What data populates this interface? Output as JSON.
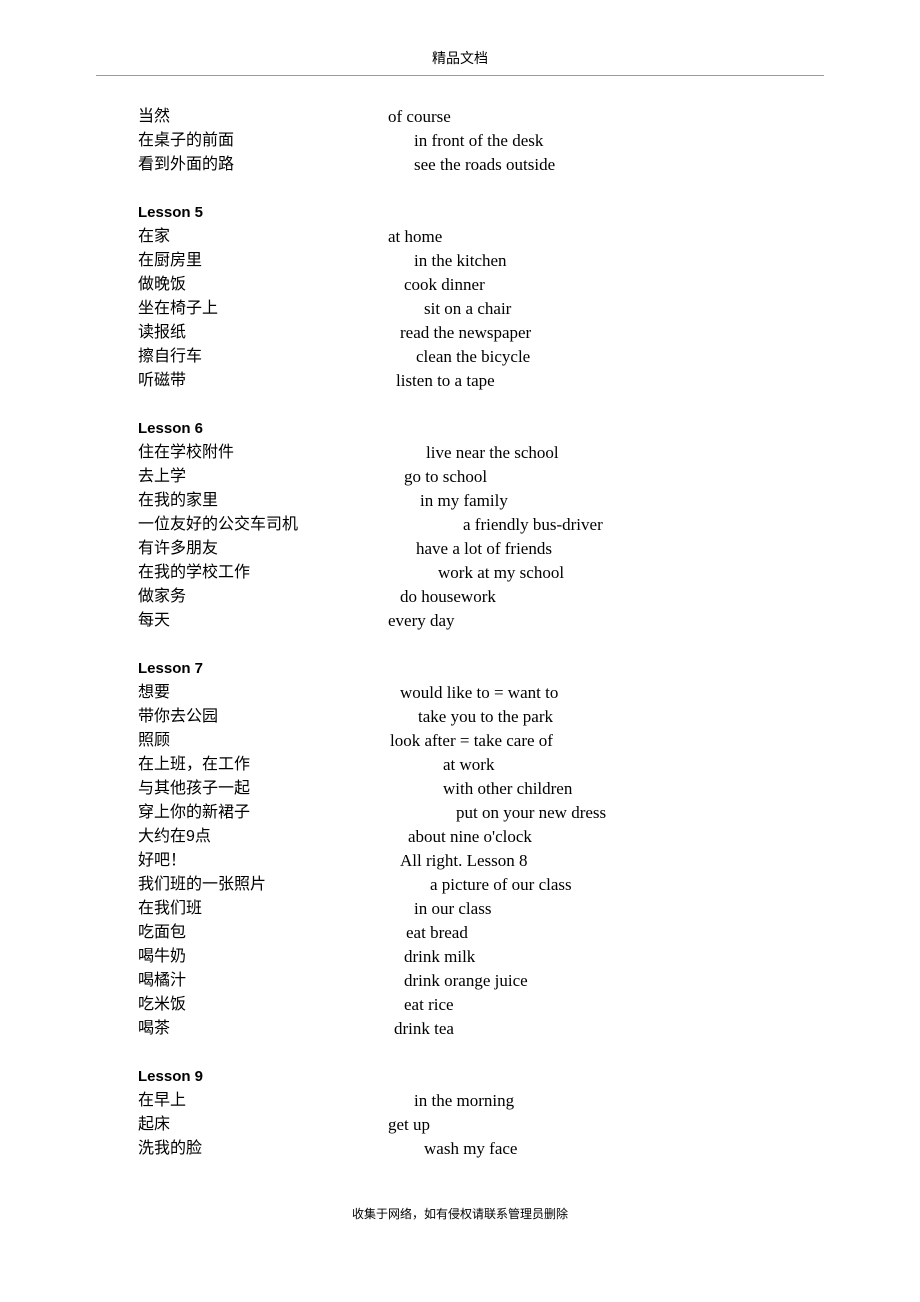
{
  "header": {
    "title": "精品文档"
  },
  "footer": {
    "text": "收集于网络，如有侵权请联系管理员删除"
  },
  "blocks": [
    {
      "heading": null,
      "rows": [
        {
          "cn": "当然",
          "en": "of course",
          "indent": 0
        },
        {
          "cn": "在桌子的前面",
          "en": "in front of the desk",
          "indent": 26
        },
        {
          "cn": "看到外面的路",
          "en": "see the roads outside",
          "indent": 26
        }
      ]
    },
    {
      "heading": "Lesson 5",
      "rows": [
        {
          "cn": "在家",
          "en": "at home",
          "indent": 0
        },
        {
          "cn": "在厨房里",
          "en": "in the kitchen",
          "indent": 26
        },
        {
          "cn": "做晚饭",
          "en": "cook dinner",
          "indent": 16
        },
        {
          "cn": "坐在椅子上",
          "en": "sit on a chair",
          "indent": 36
        },
        {
          "cn": "读报纸",
          "en": "read the newspaper",
          "indent": 12
        },
        {
          "cn": "擦自行车",
          "en": "clean the bicycle",
          "indent": 28
        },
        {
          "cn": "听磁带",
          "en": "listen to a tape",
          "indent": 8
        }
      ]
    },
    {
      "heading": "Lesson 6",
      "rows": [
        {
          "cn": "住在学校附件",
          "en": "live near the school",
          "indent": 38
        },
        {
          "cn": "去上学",
          "en": "go to school",
          "indent": 16
        },
        {
          "cn": "在我的家里",
          "en": "in my family",
          "indent": 32
        },
        {
          "cn": "一位友好的公交车司机",
          "en": "a friendly bus-driver",
          "indent": 75
        },
        {
          "cn": "有许多朋友",
          "en": "have a lot of friends",
          "indent": 28
        },
        {
          "cn": "在我的学校工作",
          "en": "work at my school",
          "indent": 50
        },
        {
          "cn": "做家务",
          "en": "do housework",
          "indent": 12
        },
        {
          "cn": "每天",
          "en": "every day",
          "indent": 0
        }
      ]
    },
    {
      "heading": "Lesson 7",
      "rows": [
        {
          "cn": "想要",
          "en": "would like to = want to",
          "indent": 12
        },
        {
          "cn": "带你去公园",
          "en": "take you to the park",
          "indent": 30
        },
        {
          "cn": "照顾",
          "en": "look after = take care of",
          "indent": 2
        },
        {
          "cn": "在上班，在工作",
          "en": "at work",
          "indent": 55
        },
        {
          "cn": "与其他孩子一起",
          "en": "with other children",
          "indent": 55
        },
        {
          "cn": "穿上你的新裙子",
          "en": "put on your new dress",
          "indent": 68
        },
        {
          "cn": "大约在9点",
          "en": "about nine o'clock",
          "indent": 20
        },
        {
          "cn": "好吧！",
          "en": "All right.   Lesson 8",
          "indent": 12
        },
        {
          "cn": "我们班的一张照片",
          "en": "a picture of our class",
          "indent": 42
        },
        {
          "cn": "在我们班",
          "en": "in our class",
          "indent": 26
        },
        {
          "cn": "吃面包",
          "en": "eat bread",
          "indent": 18
        },
        {
          "cn": "喝牛奶",
          "en": "drink milk",
          "indent": 16
        },
        {
          "cn": "喝橘汁",
          "en": "drink orange juice",
          "indent": 16
        },
        {
          "cn": "吃米饭",
          "en": "eat rice",
          "indent": 16
        },
        {
          "cn": "喝茶",
          "en": "drink tea",
          "indent": 6
        }
      ]
    },
    {
      "heading": "Lesson 9",
      "rows": [
        {
          "cn": "在早上",
          "en": "in the morning",
          "indent": 26
        },
        {
          "cn": "起床",
          "en": "get up",
          "indent": 0
        },
        {
          "cn": "洗我的脸",
          "en": "wash my face",
          "indent": 36
        }
      ]
    }
  ]
}
